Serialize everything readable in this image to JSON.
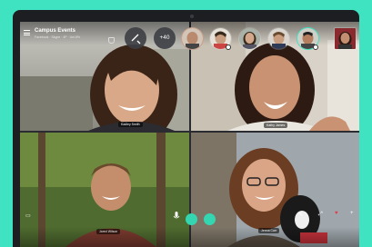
{
  "app": {
    "title": "Campus Events",
    "subtitle": "Facebook · Skype · 4P · Uni.8%"
  },
  "header": {
    "more_participants_label": "+40",
    "add_call_icon": "call-add-icon",
    "shield_icon": "shield-icon",
    "menu_icon": "hamburger-menu-icon"
  },
  "participants_strip": [
    {
      "name": "participant-1",
      "active": false
    },
    {
      "name": "participant-2",
      "active": false
    },
    {
      "name": "participant-3",
      "active": false
    },
    {
      "name": "participant-4",
      "active": false
    },
    {
      "name": "participant-5",
      "active": true
    },
    {
      "name": "participant-6",
      "active": false
    }
  ],
  "video_tiles": [
    {
      "position": "top-left",
      "name_label": "Kadley Smith"
    },
    {
      "position": "top-right",
      "name_label": "Kathy James"
    },
    {
      "position": "bottom-left",
      "name_label": "Jared Wilson"
    },
    {
      "position": "bottom-right",
      "name_label": "Jenna Carr"
    }
  ],
  "controls": {
    "mic_icon": "microphone-icon",
    "video_icon": "video-camera-icon",
    "end_call_icon": "end-call-icon",
    "screen_share_icon": "screen-share-icon",
    "chat_icon": "chat-icon",
    "heart_icon": "heart-icon",
    "add_icon": "plus-icon"
  },
  "colors": {
    "accent": "#3fe3c2",
    "bezel": "#1c1e22",
    "heart": "#e8364a"
  }
}
